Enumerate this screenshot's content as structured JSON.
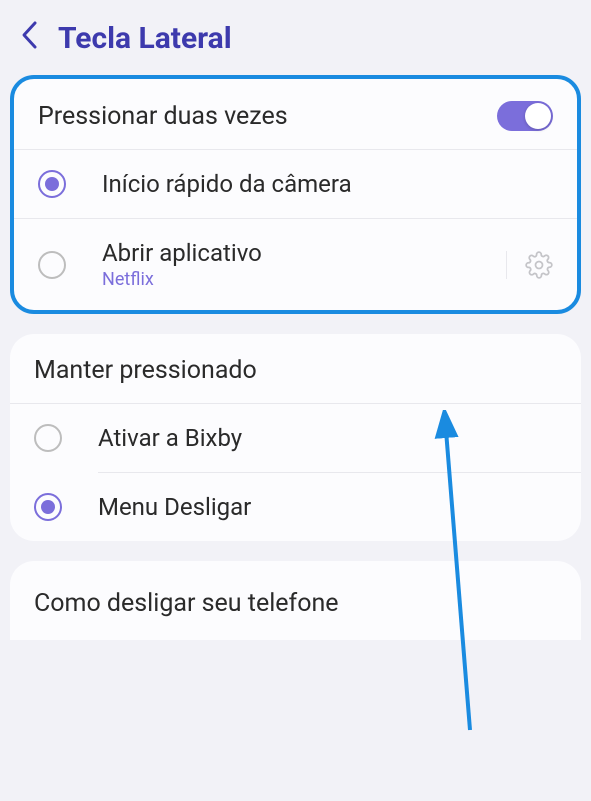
{
  "header": {
    "title": "Tecla Lateral"
  },
  "doublePress": {
    "title": "Pressionar duas vezes",
    "toggleOn": true,
    "options": [
      {
        "label": "Início rápido da câmera",
        "sublabel": null,
        "selected": true,
        "hasGear": false
      },
      {
        "label": "Abrir aplicativo",
        "sublabel": "Netflix",
        "selected": false,
        "hasGear": true
      }
    ]
  },
  "longPress": {
    "title": "Manter pressionado",
    "options": [
      {
        "label": "Ativar a Bixby",
        "selected": false
      },
      {
        "label": "Menu Desligar",
        "selected": true
      }
    ]
  },
  "footer": {
    "title": "Como desligar seu telefone"
  }
}
